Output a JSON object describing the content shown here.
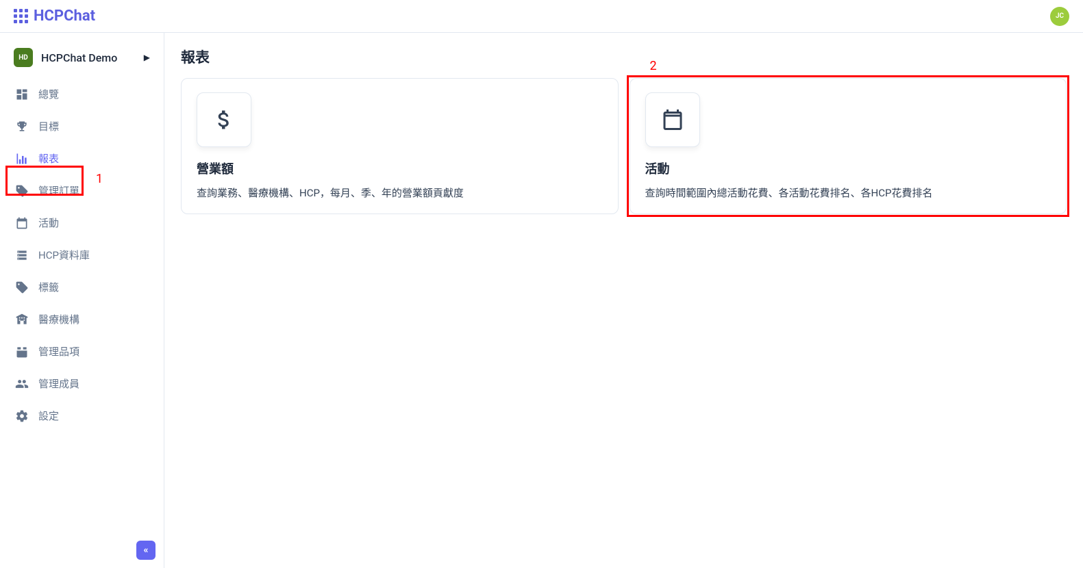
{
  "header": {
    "app_name": "HCPChat",
    "avatar_initials": "JC"
  },
  "workspace": {
    "badge": "HD",
    "name": "HCPChat Demo"
  },
  "sidebar": {
    "items": [
      {
        "label": "總覽",
        "icon": "dashboard",
        "active": false
      },
      {
        "label": "目標",
        "icon": "trophy",
        "active": false
      },
      {
        "label": "報表",
        "icon": "chart",
        "active": true
      },
      {
        "label": "管理訂單",
        "icon": "ticket",
        "active": false
      },
      {
        "label": "活動",
        "icon": "calendar",
        "active": false
      },
      {
        "label": "HCP資料庫",
        "icon": "database",
        "active": false
      },
      {
        "label": "標籤",
        "icon": "tag",
        "active": false
      },
      {
        "label": "醫療機構",
        "icon": "hospital",
        "active": false
      },
      {
        "label": "管理品項",
        "icon": "package",
        "active": false
      },
      {
        "label": "管理成員",
        "icon": "people",
        "active": false
      },
      {
        "label": "設定",
        "icon": "gear",
        "active": false
      }
    ]
  },
  "page": {
    "title": "報表"
  },
  "cards": [
    {
      "title": "營業額",
      "desc": "查詢業務、醫療機構、HCP，每月、季、年的營業額貢獻度"
    },
    {
      "title": "活動",
      "desc": "查詢時間範圍內總活動花費、各活動花費排名、各HCP花費排名"
    }
  ],
  "annotations": {
    "label1": "1",
    "label2": "2"
  }
}
